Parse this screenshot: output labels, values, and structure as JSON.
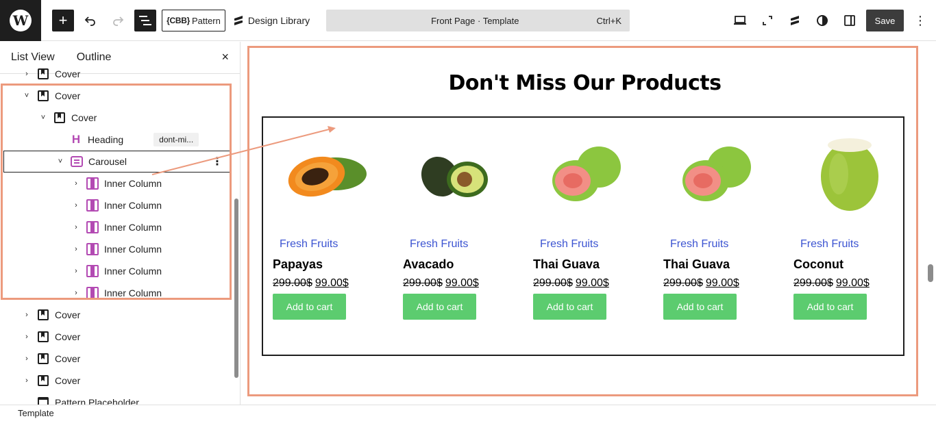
{
  "topbar": {
    "logo_glyph": "W",
    "add_icon": "plus-icon",
    "undo_icon": "undo-icon",
    "redo_icon": "redo-icon",
    "list_view_icon": "list-view-icon",
    "pattern_prefix": "{CBB}",
    "pattern_label": "Pattern",
    "design_library_label": "Design Library",
    "command_title": "Front Page · Template",
    "command_shortcut": "Ctrl+K",
    "save_label": "Save",
    "right_icons": [
      "laptop-icon",
      "fullscreen-icon",
      "stackable-icon",
      "contrast-icon",
      "sidebar-toggle-icon"
    ]
  },
  "sidebar": {
    "tabs": [
      "List View",
      "Outline"
    ],
    "close_glyph": "×",
    "rows": [
      {
        "label": "Cover",
        "type": "cover",
        "chev": "›",
        "indent": 0
      },
      {
        "label": "Cover",
        "type": "cover",
        "chev": "˅",
        "indent": 0
      },
      {
        "label": "Cover",
        "type": "cover",
        "chev": "˅",
        "indent": 1
      },
      {
        "label": "Heading",
        "type": "heading",
        "chev": "",
        "indent": 2,
        "badge": "dont-mi..."
      },
      {
        "label": "Carousel",
        "type": "carousel",
        "chev": "˅",
        "indent": 2,
        "selected": true
      },
      {
        "label": "Inner Column",
        "type": "innercol",
        "chev": "›",
        "indent": 3
      },
      {
        "label": "Inner Column",
        "type": "innercol",
        "chev": "›",
        "indent": 3
      },
      {
        "label": "Inner Column",
        "type": "innercol",
        "chev": "›",
        "indent": 3
      },
      {
        "label": "Inner Column",
        "type": "innercol",
        "chev": "›",
        "indent": 3
      },
      {
        "label": "Inner Column",
        "type": "innercol",
        "chev": "›",
        "indent": 3
      },
      {
        "label": "Inner Column",
        "type": "innercol",
        "chev": "›",
        "indent": 3
      },
      {
        "label": "Cover",
        "type": "cover",
        "chev": "›",
        "indent": 0
      },
      {
        "label": "Cover",
        "type": "cover",
        "chev": "›",
        "indent": 0
      },
      {
        "label": "Cover",
        "type": "cover",
        "chev": "›",
        "indent": 0
      },
      {
        "label": "Cover",
        "type": "cover",
        "chev": "›",
        "indent": 0
      },
      {
        "label": "Pattern Placeholder",
        "type": "pattern",
        "chev": "",
        "indent": 0
      }
    ]
  },
  "canvas": {
    "heading": "Don't Miss Our Products",
    "products": [
      {
        "category": "Fresh Fruits",
        "name": "Papayas",
        "old_price": "299.00$",
        "new_price": "99.00$",
        "button": "Add to cart",
        "image": "papaya"
      },
      {
        "category": "Fresh Fruits",
        "name": "Avacado",
        "old_price": "299.00$",
        "new_price": "99.00$",
        "button": "Add to cart",
        "image": "avocado"
      },
      {
        "category": "Fresh Fruits",
        "name": "Thai Guava",
        "old_price": "299.00$",
        "new_price": "99.00$",
        "button": "Add to cart",
        "image": "guava"
      },
      {
        "category": "Fresh Fruits",
        "name": "Thai Guava",
        "old_price": "299.00$",
        "new_price": "99.00$",
        "button": "Add to cart",
        "image": "guava"
      },
      {
        "category": "Fresh Fruits",
        "name": "Coconut",
        "old_price": "299.00$",
        "new_price": "99.00$",
        "button": "Add to cart",
        "image": "coconut"
      }
    ]
  },
  "footer": {
    "breadcrumb": "Template"
  },
  "colors": {
    "highlight": "#ec9a7d",
    "button_green": "#5ccc6f",
    "category_blue": "#3b53d1",
    "block_icon_purple": "#b34ab3"
  }
}
